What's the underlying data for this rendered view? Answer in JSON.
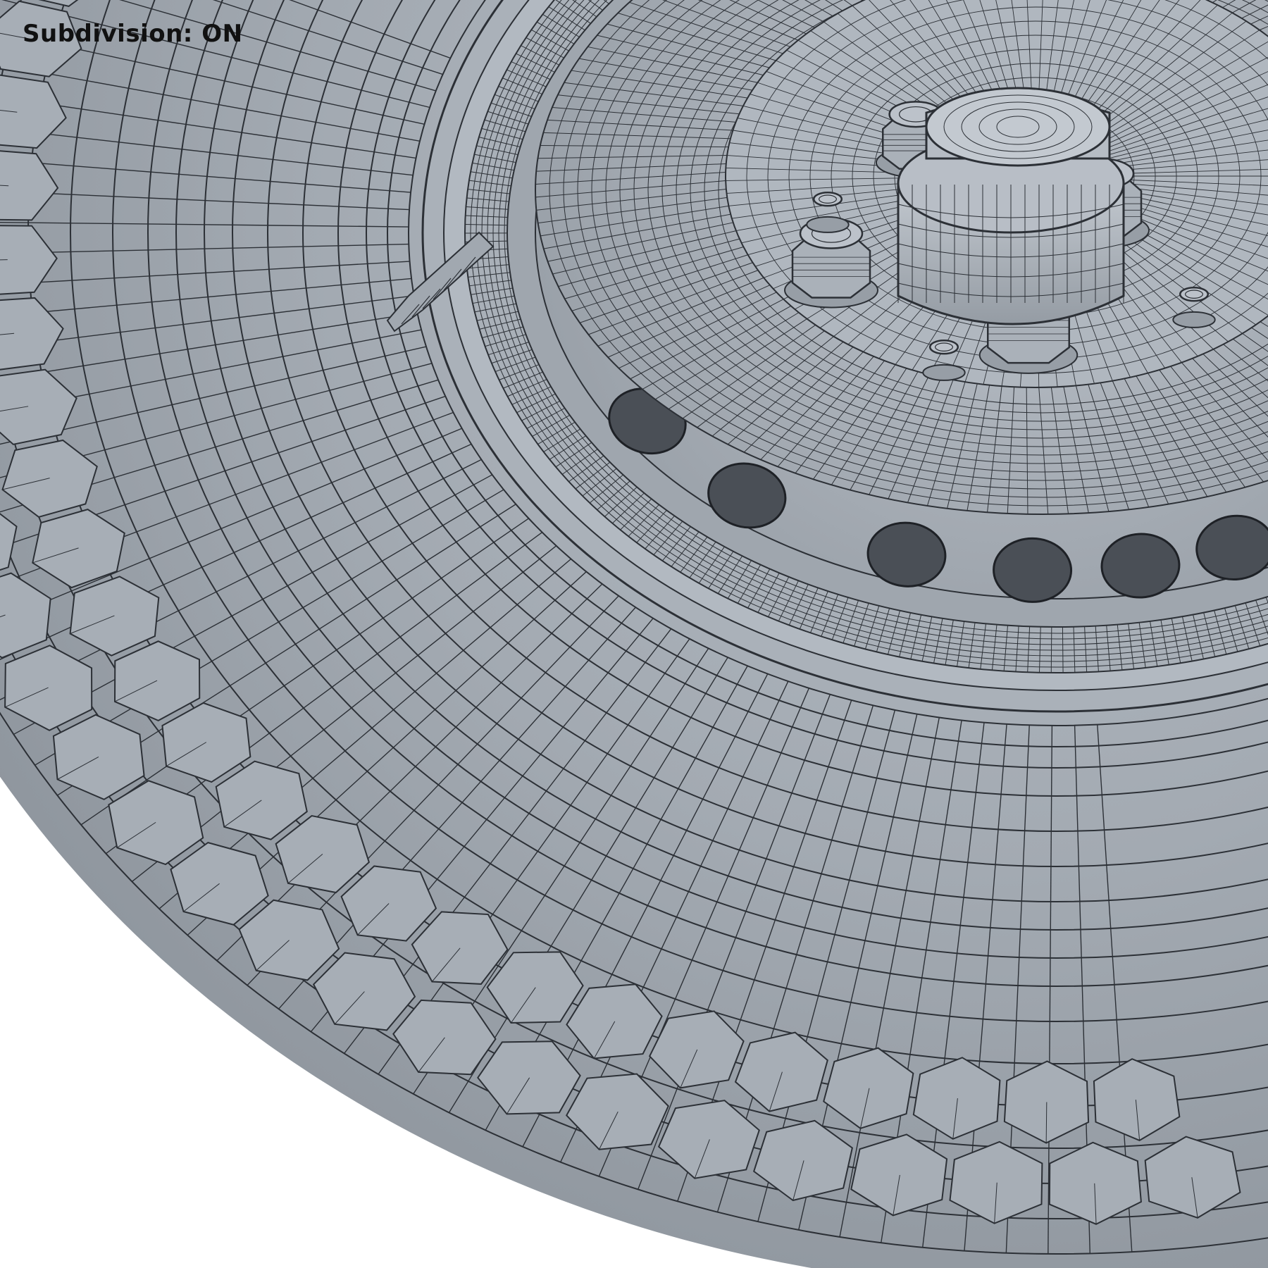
{
  "viewport": {
    "overlay_label": "Subdivision: ON",
    "render_mode": "wireframe-on-shaded",
    "colors": {
      "background": "#ffffff",
      "surface": "#a3aab2",
      "surface_light": "#b4bbc3",
      "surface_dark": "#8d949c",
      "wire": "#2c3036",
      "hole": "#4a4f56",
      "label": "#111111"
    },
    "icons": [
      "wheel-model-icon"
    ]
  }
}
